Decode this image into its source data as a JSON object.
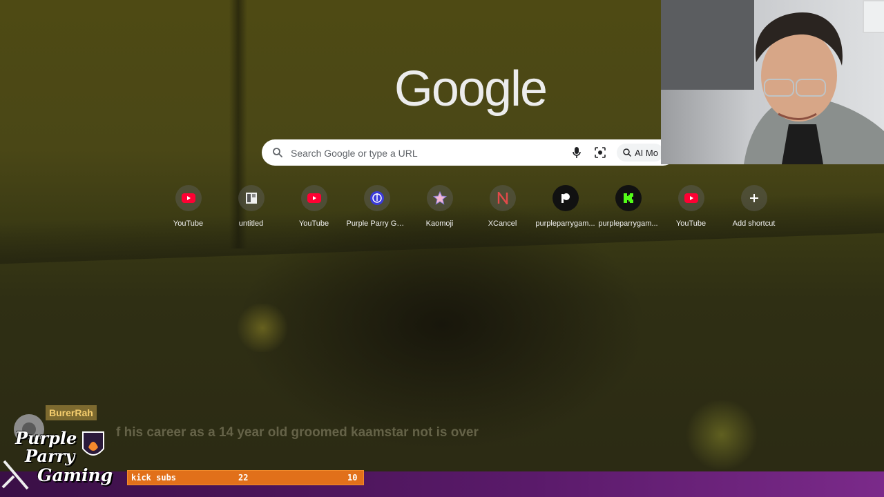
{
  "search": {
    "placeholder": "Search Google or type a URL",
    "ai_mode_label": "AI Mo"
  },
  "logo": {
    "text": "Google"
  },
  "shortcuts": [
    {
      "label": "YouTube",
      "icon": "youtube-icon"
    },
    {
      "label": "untitled",
      "icon": "untitled-icon"
    },
    {
      "label": "YouTube",
      "icon": "youtube-icon"
    },
    {
      "label": "Purple Parry Ga...",
      "icon": "purple-parry-icon"
    },
    {
      "label": "Kaomoji",
      "icon": "kaomoji-icon"
    },
    {
      "label": "XCancel",
      "icon": "xcancel-icon"
    },
    {
      "label": "purpleparrygam...",
      "icon": "patreon-icon"
    },
    {
      "label": "purpleparrygam...",
      "icon": "kick-icon"
    },
    {
      "label": "YouTube",
      "icon": "youtube-icon"
    },
    {
      "label": "Add shortcut",
      "icon": "plus-icon"
    }
  ],
  "overlay": {
    "chat_username": "BurerRah",
    "chat_message": "f his career as a 14 year old groomed kaamstar not is over",
    "subs_label": "kick subs",
    "subs_count": "22",
    "subs_goal": "10",
    "brand_line1": "Purple",
    "brand_line2": "Parry",
    "brand_line3": "Gaming"
  },
  "colors": {
    "youtube": "#ff0033",
    "kick": "#53fc18",
    "purple": "#5a1a6a",
    "orange": "#e1701a"
  }
}
